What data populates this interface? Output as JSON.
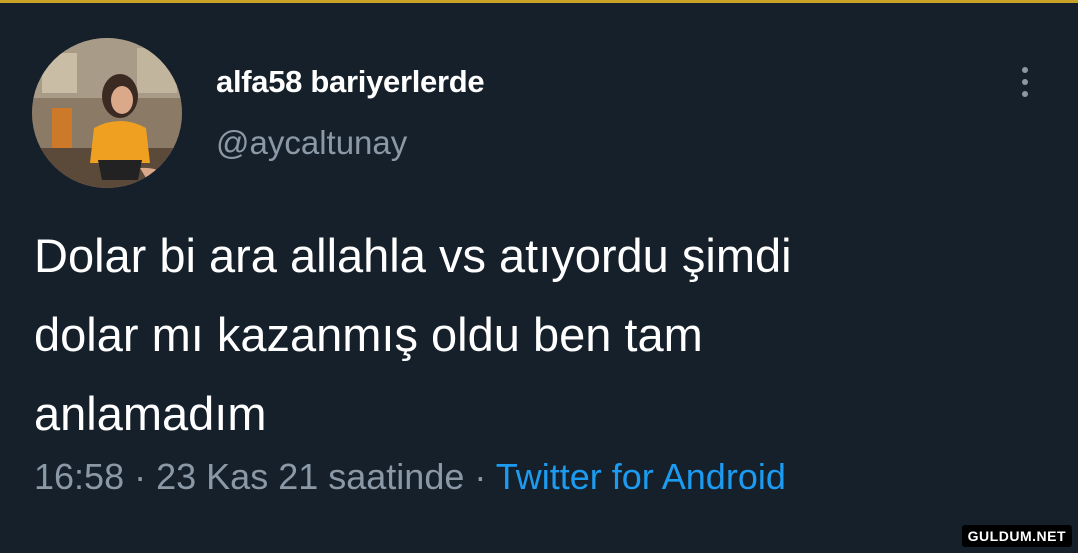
{
  "tweet": {
    "display_name": "alfa58 bariyerlerde",
    "handle": "@aycaltunay",
    "text_lines": [
      "Dolar bi ara allahla vs atıyordu şimdi",
      "dolar mı kazanmış oldu ben tam",
      "anlamadım"
    ],
    "time": "16:58",
    "date": "23 Kas 21 saatinde",
    "separator": "·",
    "source": "Twitter for Android"
  },
  "icons": {
    "more": "more-vertical-icon"
  },
  "colors": {
    "background": "#15202b",
    "text_primary": "#ffffff",
    "text_secondary": "#8b98a5",
    "link": "#1d9bf0"
  },
  "watermark": "GULDUM.NET"
}
